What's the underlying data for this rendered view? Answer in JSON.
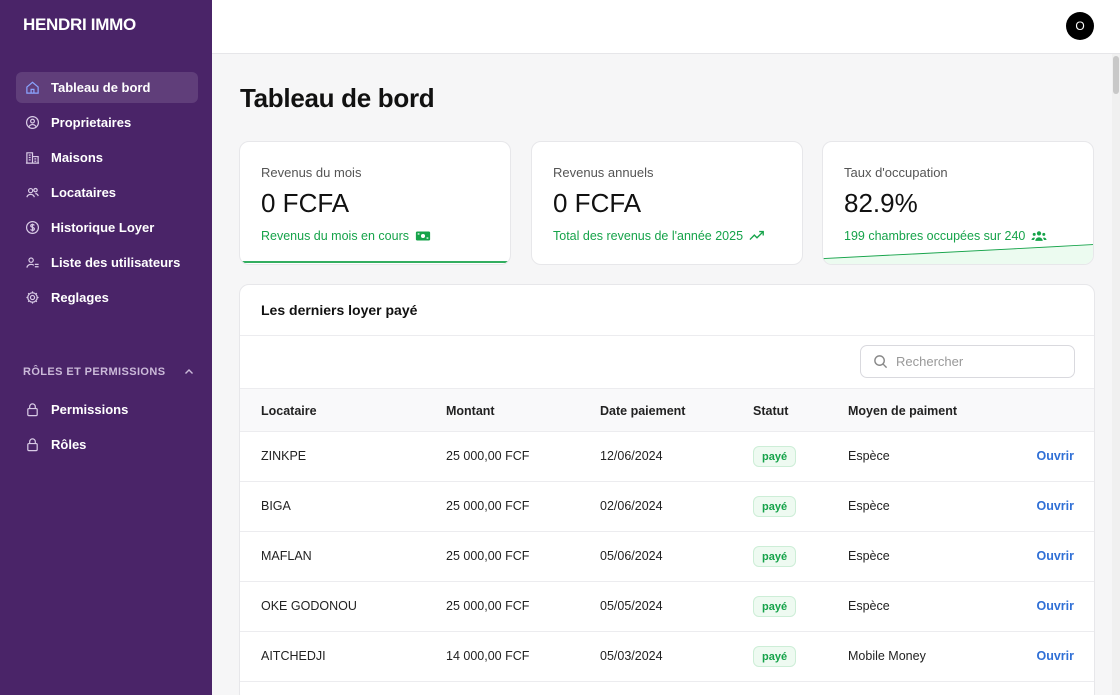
{
  "brand": "HENDRI IMMO",
  "nav": [
    {
      "label": "Tableau de bord",
      "icon": "home-icon",
      "active": true
    },
    {
      "label": "Proprietaires",
      "icon": "user-circle-icon"
    },
    {
      "label": "Maisons",
      "icon": "building-icon"
    },
    {
      "label": "Locataires",
      "icon": "users-icon"
    },
    {
      "label": "Historique Loyer",
      "icon": "dollar-circle-icon"
    },
    {
      "label": "Liste des utilisateurs",
      "icon": "user-list-icon"
    },
    {
      "label": "Reglages",
      "icon": "settings-icon"
    }
  ],
  "roles_section": {
    "title": "RÔLES ET PERMISSIONS",
    "items": [
      {
        "label": "Permissions",
        "icon": "lock-icon"
      },
      {
        "label": "Rôles",
        "icon": "lock-icon"
      }
    ]
  },
  "topbar": {
    "avatar_initial": "O"
  },
  "page_title": "Tableau de bord",
  "cards": [
    {
      "label": "Revenus du mois",
      "value": "0 FCFA",
      "sub": "Revenus du mois en cours",
      "icon": "money-icon"
    },
    {
      "label": "Revenus annuels",
      "value": "0 FCFA",
      "sub": "Total des revenus de l'année 2025",
      "icon": "trending-up-icon"
    },
    {
      "label": "Taux d'occupation",
      "value": "82.9%",
      "sub": "199 chambres occupées sur 240",
      "icon": "users-group-icon"
    }
  ],
  "table": {
    "title": "Les derniers loyer payé",
    "search_placeholder": "Rechercher",
    "headers": {
      "locataire": "Locataire",
      "montant": "Montant",
      "date": "Date paiement",
      "statut": "Statut",
      "moyen": "Moyen de paiment"
    },
    "rows": [
      {
        "locataire": "ZINKPE",
        "montant": "25 000,00 FCF",
        "date": "12/06/2024",
        "statut": "payé",
        "moyen": "Espèce",
        "action": "Ouvrir"
      },
      {
        "locataire": "BIGA",
        "montant": "25 000,00 FCF",
        "date": "02/06/2024",
        "statut": "payé",
        "moyen": "Espèce",
        "action": "Ouvrir"
      },
      {
        "locataire": "MAFLAN",
        "montant": "25 000,00 FCF",
        "date": "05/06/2024",
        "statut": "payé",
        "moyen": "Espèce",
        "action": "Ouvrir"
      },
      {
        "locataire": "OKE GODONOU",
        "montant": "25 000,00 FCF",
        "date": "05/05/2024",
        "statut": "payé",
        "moyen": "Espèce",
        "action": "Ouvrir"
      },
      {
        "locataire": "AITCHEDJI",
        "montant": "14 000,00 FCF",
        "date": "05/03/2024",
        "statut": "payé",
        "moyen": "Mobile Money",
        "action": "Ouvrir"
      }
    ]
  },
  "colors": {
    "sidebar": "#4a2468",
    "accent_green": "#16a34a",
    "link_blue": "#2f6fd6"
  }
}
